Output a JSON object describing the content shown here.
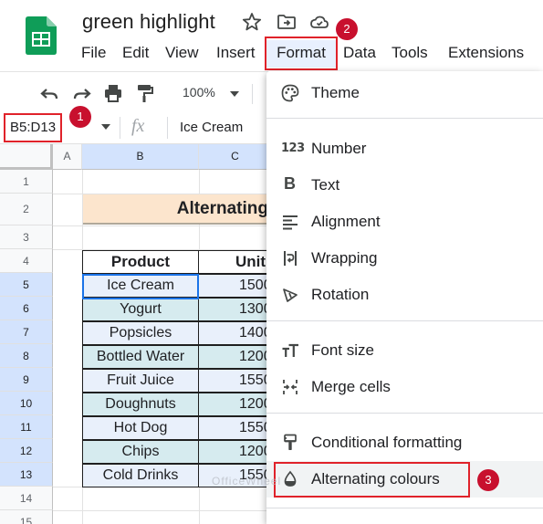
{
  "app": {
    "doc_title": "green highlight",
    "menu": [
      "File",
      "Edit",
      "View",
      "Insert",
      "Format",
      "Data",
      "Tools",
      "Extensions"
    ]
  },
  "toolbar": {
    "zoom": "100%"
  },
  "formula_bar": {
    "name_box": "B5:D13",
    "formula_value": "Ice Cream"
  },
  "grid": {
    "columns": [
      "A",
      "B",
      "C"
    ],
    "rows": [
      "1",
      "2",
      "3",
      "4",
      "5",
      "6",
      "7",
      "8",
      "9",
      "10",
      "11",
      "12",
      "13",
      "14"
    ],
    "title": "Alternating",
    "headers": [
      "Product",
      "Unit"
    ],
    "products": [
      "Ice Cream",
      "Yogurt",
      "Popsicles",
      "Bottled Water",
      "Fruit Juice",
      "Doughnuts",
      "Hot Dog",
      "Chips",
      "Cold Drinks"
    ],
    "units": [
      "1500",
      "1300",
      "1400",
      "1200",
      "1550",
      "1200",
      "1550",
      "1200",
      "1550"
    ]
  },
  "format_menu": {
    "items": [
      "Theme",
      "Number",
      "Text",
      "Alignment",
      "Wrapping",
      "Rotation",
      "Font size",
      "Merge cells",
      "Conditional formatting",
      "Alternating colours"
    ]
  },
  "annotations": {
    "badges": [
      "1",
      "2",
      "3"
    ]
  },
  "watermark": "OfficeWheel",
  "colors": {
    "highlight_red": "#e0222a",
    "badge_red": "#c8102e",
    "title_fill": "#fce5cd",
    "alt_row_a": "#e9f0fb",
    "alt_row_b": "#d6ebef",
    "selection_blue": "#1a73e8",
    "sheets_green": "#0f9d58"
  },
  "icons": [
    "sheets-logo-icon",
    "star-icon",
    "move-to-folder-icon",
    "cloud-status-icon",
    "undo-icon",
    "redo-icon",
    "print-icon",
    "paint-format-icon",
    "chevron-down-icon",
    "palette-icon",
    "number-123-icon",
    "bold-text-icon",
    "align-left-icon",
    "wrap-text-icon",
    "rotation-icon",
    "font-size-icon",
    "merge-cells-icon",
    "paint-roller-icon",
    "fill-drop-icon"
  ]
}
